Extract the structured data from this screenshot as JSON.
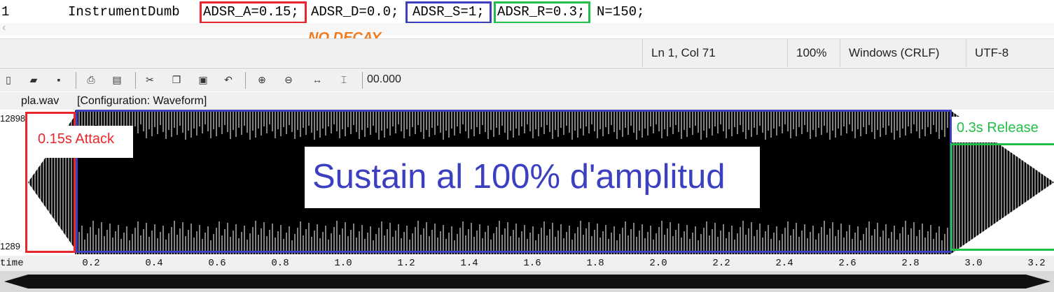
{
  "editor": {
    "line_number": "1",
    "code_name": "InstrumentDumb",
    "params": {
      "attack": "ADSR_A=0.15;",
      "decay": "ADSR_D=0.0;",
      "sustain": "ADSR_S=1;",
      "release": "ADSR_R=0.3;",
      "n": "N=150;"
    }
  },
  "annotation_no_decay": "NO DECAY",
  "statusbar": {
    "position": "Ln 1, Col 71",
    "zoom": "100%",
    "line_ending": "Windows (CRLF)",
    "encoding": "UTF-8"
  },
  "toolbar": {
    "icons": [
      "new-file-icon",
      "open-folder-icon",
      "save-icon",
      "print-icon",
      "properties-icon",
      "cut-icon",
      "copy-icon",
      "paste-icon",
      "undo-icon",
      "zoom-in-icon",
      "zoom-out-icon",
      "fit-width-icon",
      "cursor-position-icon"
    ],
    "time": "00.000"
  },
  "file": {
    "name": "pla.wav",
    "configuration": "[Configuration: Waveform]"
  },
  "waveform": {
    "y_top": "12898",
    "y_bottom": "1289",
    "attack_label": "0.15s Attack",
    "sustain_label": "Sustain al 100% d'amplitud",
    "release_label": "0.3s Release",
    "colors": {
      "attack": "#e8262c",
      "sustain": "#3b3fc0",
      "release": "#22c04a",
      "no_decay": "#f07a1e"
    },
    "attack_s": 0.15,
    "release_s": 0.3,
    "sustain_level": 1.0,
    "duration_s": 3.25
  },
  "axis": {
    "label": "time",
    "ticks": [
      "0.2",
      "0.4",
      "0.6",
      "0.8",
      "1.0",
      "1.2",
      "1.4",
      "1.6",
      "1.8",
      "2.0",
      "2.2",
      "2.4",
      "2.6",
      "2.8",
      "3.0",
      "3.2"
    ]
  }
}
